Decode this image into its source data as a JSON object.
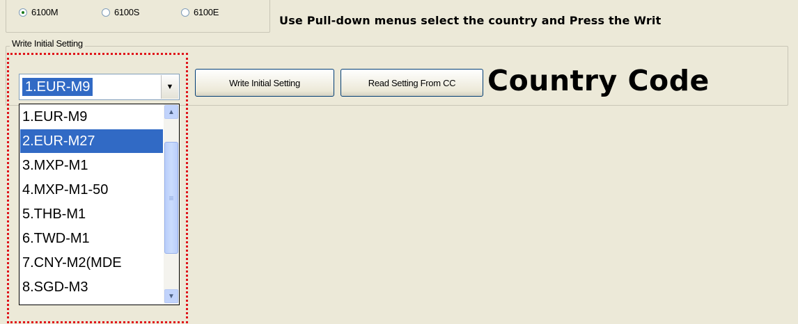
{
  "model_radio": {
    "options": [
      "6100M",
      "6100S",
      "6100E"
    ],
    "selected": "6100M"
  },
  "instruction": "Use Pull-down menus select the country and Press the Writ",
  "group": {
    "title": "Write Initial Setting"
  },
  "combo": {
    "value": "1.EUR-M9"
  },
  "buttons": {
    "write": "Write Initial Setting",
    "read": "Read Setting From CC"
  },
  "title": "Country Code",
  "dropdown": {
    "items": [
      "1.EUR-M9",
      "2.EUR-M27",
      "3.MXP-M1",
      "4.MXP-M1-50",
      "5.THB-M1",
      "6.TWD-M1",
      "7.CNY-M2(MDE",
      "8.SGD-M3"
    ],
    "highlighted": "2.EUR-M27"
  },
  "icons": {
    "dropdown_arrow": "chevron-down-icon",
    "scroll_up": "scroll-up-icon",
    "scroll_down": "scroll-down-icon",
    "scroll_grip": "grip-icon"
  },
  "colors": {
    "background": "#ece9d8",
    "selection": "#316ac5",
    "highlight_border": "#e0141a"
  }
}
